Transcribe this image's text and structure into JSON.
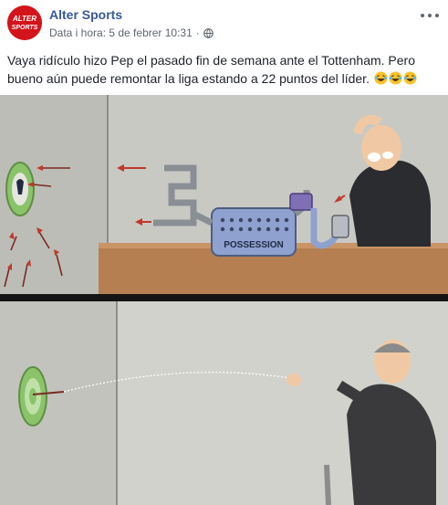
{
  "post": {
    "page_name": "Alter Sports",
    "avatar_text_line1": "ALTER",
    "avatar_text_line2": "SPORTS",
    "timestamp": "Data i hora: 5 de febrer 10:31",
    "separator": "·",
    "privacy_icon": "globe-icon",
    "more_icon": "more-options-icon",
    "text": "Vaya ridículo hizo Pep el pasado fin de semana ante el Tottenham. Pero bueno aún puede remontar la liga estando a 22 puntos del líder.",
    "emojis": [
      "laughing-tears-emoji",
      "laughing-tears-emoji",
      "laughing-tears-emoji"
    ]
  },
  "image": {
    "machine_label": "POSSESSION",
    "colors": {
      "wall": "#c9c9c4",
      "floor": "#9b9b94",
      "desk": "#b57f52",
      "machine_blue": "#8ea1cf",
      "arrow_red": "#c0392b",
      "target_green": "#8bc36a",
      "divider": "#141414"
    }
  }
}
